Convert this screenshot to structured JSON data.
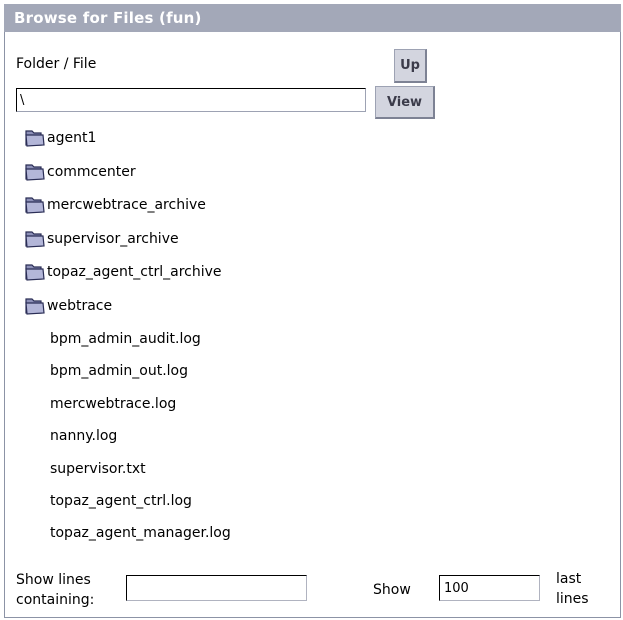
{
  "window": {
    "title": "Browse for Files (fun)"
  },
  "browser": {
    "folder_file_label": "Folder / File",
    "up_button": "Up",
    "view_button": "View",
    "path_value": "\\"
  },
  "folders": [
    {
      "name": "agent1"
    },
    {
      "name": "commcenter"
    },
    {
      "name": "mercwebtrace_archive"
    },
    {
      "name": "supervisor_archive"
    },
    {
      "name": "topaz_agent_ctrl_archive"
    },
    {
      "name": "webtrace"
    }
  ],
  "files": [
    {
      "name": "bpm_admin_audit.log"
    },
    {
      "name": "bpm_admin_out.log"
    },
    {
      "name": "mercwebtrace.log"
    },
    {
      "name": "nanny.log"
    },
    {
      "name": "supervisor.txt"
    },
    {
      "name": "topaz_agent_ctrl.log"
    },
    {
      "name": "topaz_agent_manager.log"
    }
  ],
  "filter": {
    "show_lines_label_1": "Show lines",
    "show_lines_label_2": "containing:",
    "containing_value": "",
    "show_label": "Show",
    "show_count_value": "100",
    "last_label_1": "last",
    "last_label_2": "lines"
  },
  "colors": {
    "titlebar": "#a3a8b8",
    "folder_icon": "#8d90b8",
    "button_face": "#d3d5df"
  }
}
